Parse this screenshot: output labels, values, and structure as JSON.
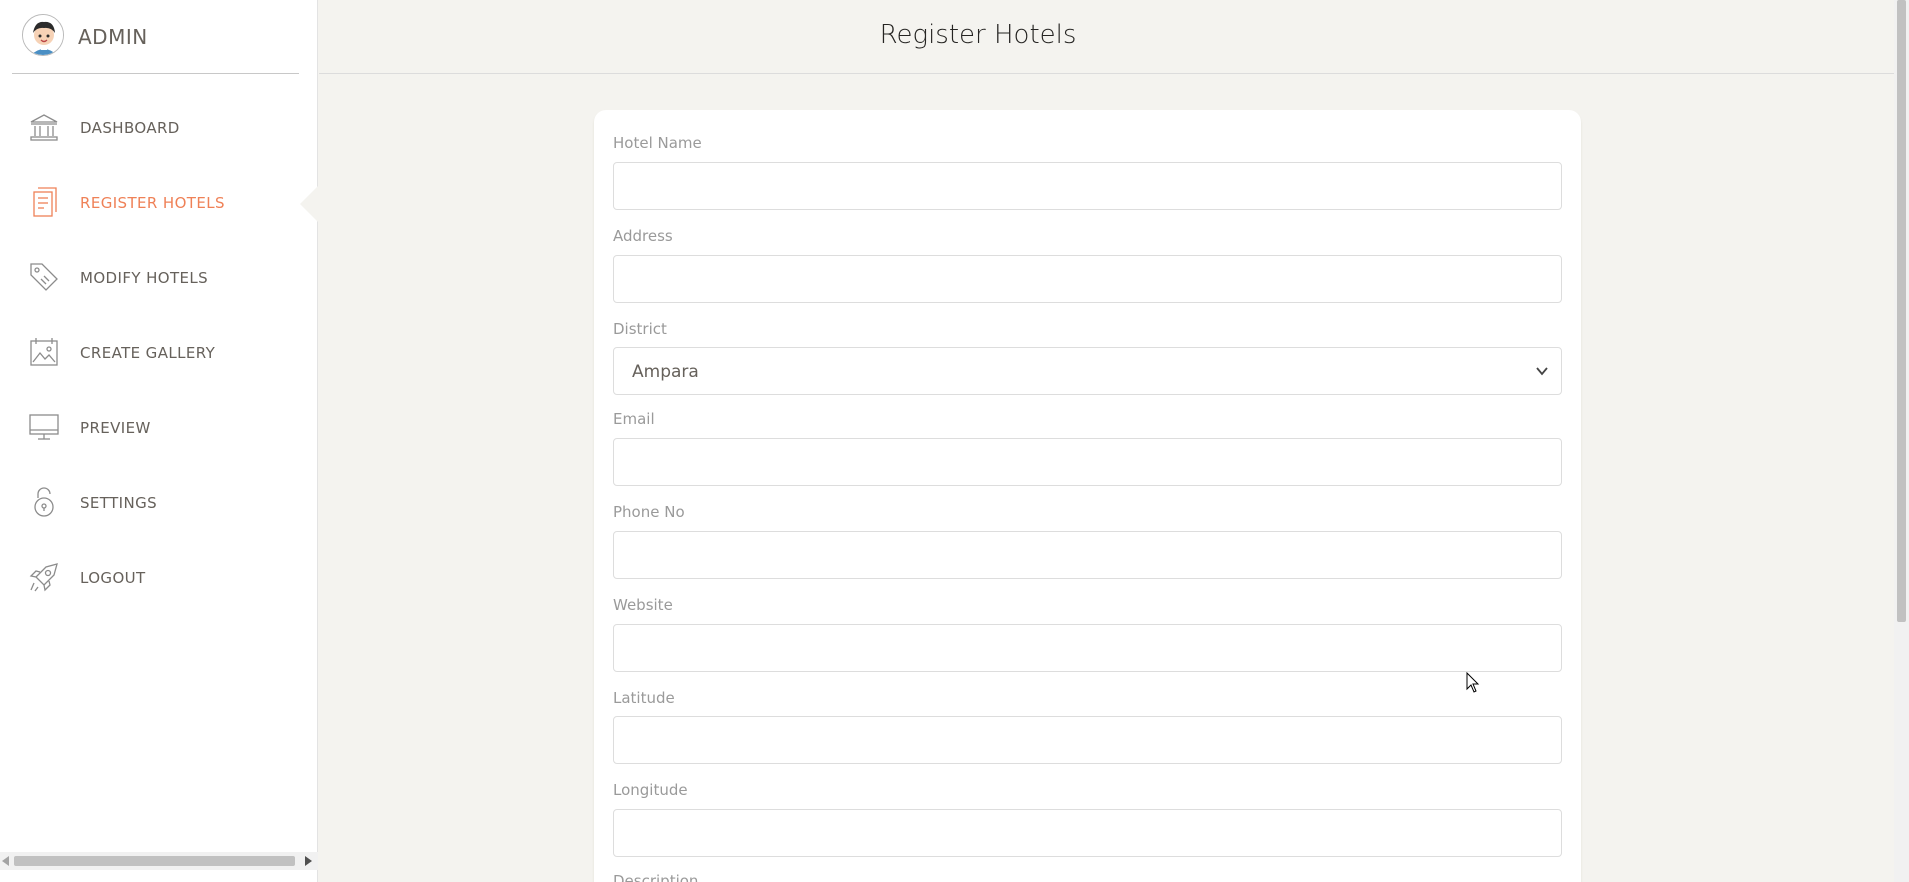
{
  "brand": {
    "title": "ADMIN"
  },
  "sidebar": {
    "items": [
      {
        "label": "DASHBOARD",
        "icon": "bank-icon"
      },
      {
        "label": "REGISTER HOTELS",
        "icon": "paper-icon",
        "active": true
      },
      {
        "label": "MODIFY HOTELS",
        "icon": "tag-icon"
      },
      {
        "label": "CREATE GALLERY",
        "icon": "album-icon"
      },
      {
        "label": "PREVIEW",
        "icon": "monitor-icon"
      },
      {
        "label": "SETTINGS",
        "icon": "lock-icon"
      },
      {
        "label": "LOGOUT",
        "icon": "spaceship-icon"
      }
    ]
  },
  "header": {
    "title": "Register Hotels"
  },
  "form": {
    "hotel_name": {
      "label": "Hotel Name",
      "value": ""
    },
    "address": {
      "label": "Address",
      "value": ""
    },
    "district": {
      "label": "District",
      "selected": "Ampara"
    },
    "email": {
      "label": "Email",
      "value": ""
    },
    "phone": {
      "label": "Phone No",
      "value": ""
    },
    "website": {
      "label": "Website",
      "value": ""
    },
    "latitude": {
      "label": "Latitude",
      "value": ""
    },
    "longitude": {
      "label": "Longitude",
      "value": ""
    },
    "description": {
      "label": "Description"
    }
  },
  "colors": {
    "accent": "#ef8157",
    "text": "#66615b",
    "background": "#f4f3ef"
  }
}
